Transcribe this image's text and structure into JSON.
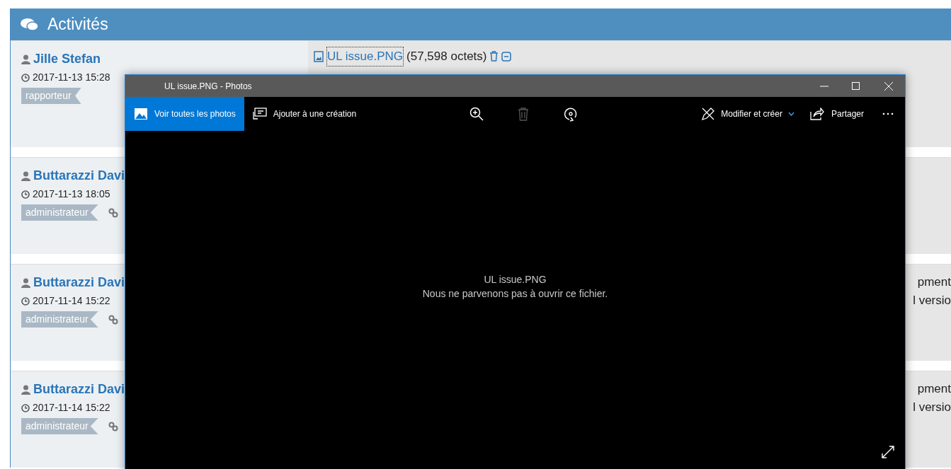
{
  "panel": {
    "title": "Activités"
  },
  "activities": [
    {
      "author": "Jille Stefan",
      "date": "2017-11-13 15:28",
      "role": "rapporteur",
      "link": false,
      "attachment": {
        "name": "UL issue.PNG",
        "size": "(57,598 octets)"
      }
    },
    {
      "author": "Buttarazzi Davi",
      "date": "2017-11-13 18:05",
      "role": "administrateur",
      "link": true
    },
    {
      "author": "Buttarazzi Davi",
      "date": "2017-11-14 15:22",
      "role": "administrateur",
      "link": true,
      "lines": [
        "pment",
        "l versio"
      ]
    },
    {
      "author": "Buttarazzi Davi",
      "date": "2017-11-14 15:22",
      "role": "administrateur",
      "link": true,
      "lines": [
        "pment",
        "l versio"
      ]
    }
  ],
  "photos_window": {
    "title": "UL issue.PNG - Photos",
    "toolbar": [
      {
        "label": "Voir toutes les photos",
        "selected": true
      },
      {
        "label": "Ajouter à une création",
        "selected": false
      }
    ],
    "edit_menu": "Modifier et créer",
    "share": "Partager",
    "file_name": "UL issue.PNG",
    "message": "Nous ne parvenons pas à ouvrir ce fichier."
  }
}
